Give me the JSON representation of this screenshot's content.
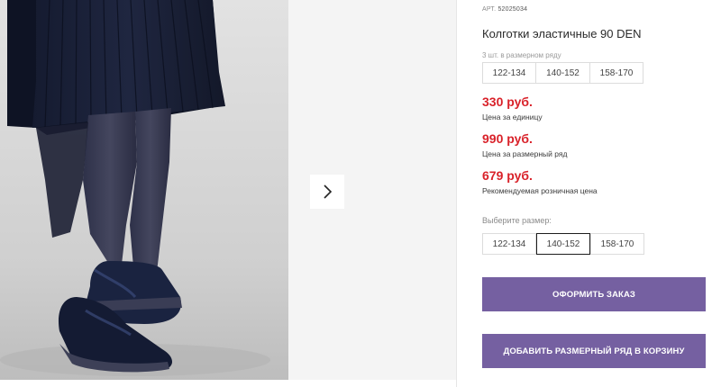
{
  "gallery": {
    "next_icon": "chevron-right-icon",
    "photo_alt": "product-photo"
  },
  "product": {
    "art_label": "АРТ.",
    "art_code": "52025034",
    "title": "Колготки эластичные 90 DEN",
    "set_label": "3 шт. в размерном ряду",
    "set_sizes": [
      "122-134",
      "140-152",
      "158-170"
    ],
    "unit_price": "330 руб.",
    "unit_price_note": "Цена за единицу",
    "set_price": "990 руб.",
    "set_price_note": "Цена за размерный ряд",
    "retail_price": "679 руб.",
    "retail_price_note": "Рекомендуемая розничная цена",
    "choose_label": "Выберите размер:",
    "size_options": [
      "122-134",
      "140-152",
      "158-170"
    ],
    "selected_size": "140-152",
    "order_button": "ОФОРМИТЬ ЗАКАЗ",
    "add_set_button": "ДОБАВИТЬ РАЗМЕРНЫЙ РЯД В КОРЗИНУ"
  },
  "colors": {
    "price": "#d9222a",
    "button": "#7560a1"
  }
}
